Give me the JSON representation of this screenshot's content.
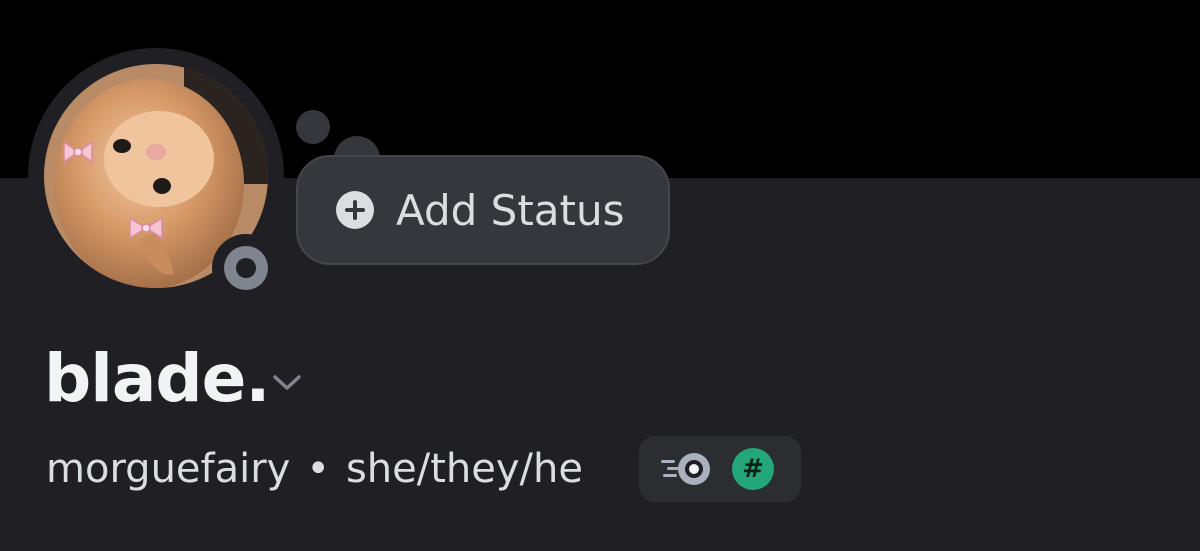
{
  "profile": {
    "display_name": "blade.",
    "username": "morguefairy",
    "separator": "•",
    "pronouns": "she/they/he",
    "online_status": "offline"
  },
  "status": {
    "add_label": "Add Status"
  },
  "badges": {
    "items": [
      {
        "icon": "nitro-icon"
      },
      {
        "icon": "hashtag-icon",
        "glyph": "#"
      }
    ]
  },
  "avatar": {
    "icon": "avatar-kitten-image"
  },
  "colors": {
    "banner": "#000000",
    "surface": "#1f1f24",
    "bubble": "#36373d",
    "text_primary": "#f2f3f5",
    "text_secondary": "#dbdee1",
    "status_offline": "#80848e",
    "hashtag_badge": "#23a77a"
  }
}
